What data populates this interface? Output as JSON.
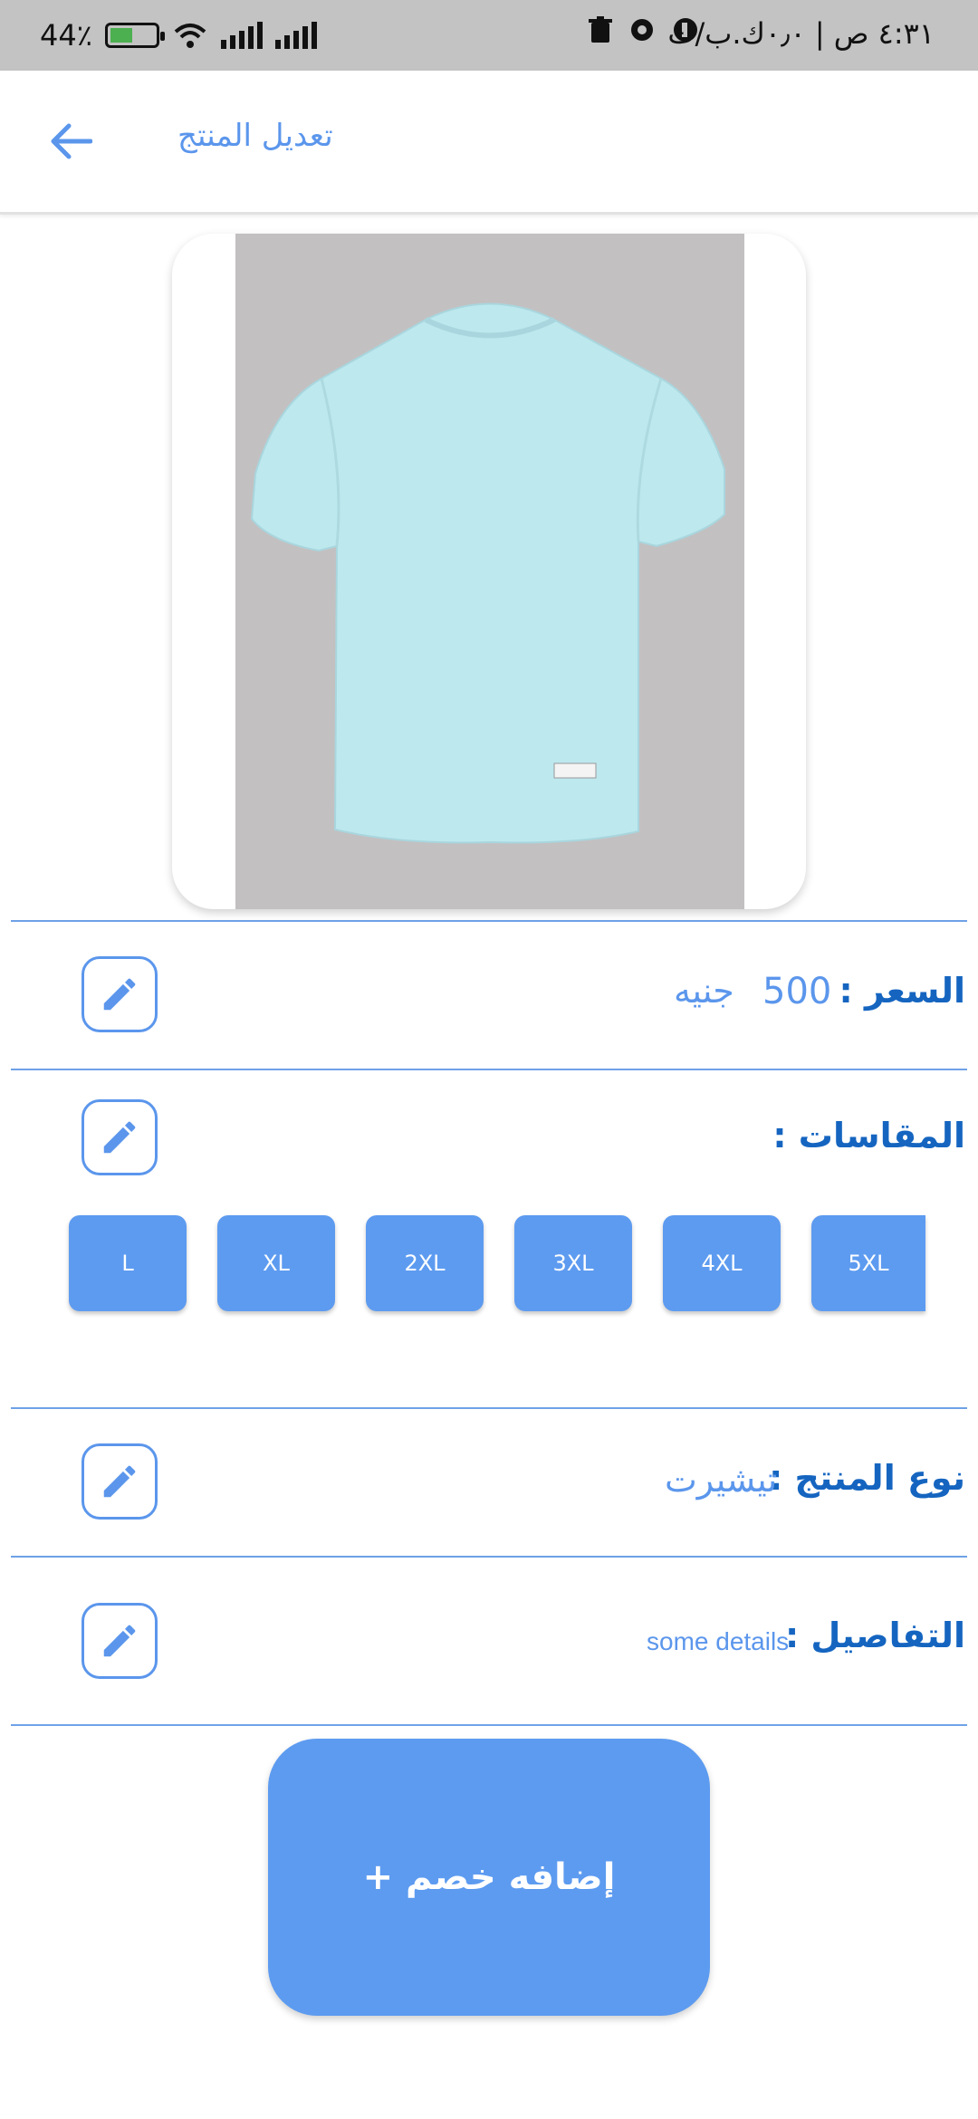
{
  "status_bar": {
    "time": "٤:٣١ ص | ٠٫٠ك.ب/ث",
    "battery": "44٪"
  },
  "header": {
    "title": "تعديل المنتج",
    "back_icon": "arrow-left-icon"
  },
  "product_image": {
    "icon": "tshirt-image",
    "shirt_color": "#bde8ee",
    "background_color": "#c3c0c1"
  },
  "price": {
    "label": "السعر :",
    "value": "500",
    "currency": "جنيه",
    "edit_icon": "pencil-icon"
  },
  "sizes": {
    "label": "المقاسات :",
    "edit_icon": "pencil-icon",
    "items": [
      "L",
      "XL",
      "2XL",
      "3XL",
      "4XL",
      "5XL"
    ]
  },
  "product_type": {
    "label": "نوع المنتج :",
    "value": "تيشيرت",
    "edit_icon": "pencil-icon"
  },
  "details": {
    "label": "التفاصيل :",
    "value": "some details",
    "edit_icon": "pencil-icon"
  },
  "discount_button": {
    "label": "إضافه خصم +"
  },
  "colors": {
    "accent": "#5d9bf0",
    "label_blue": "#1565c0",
    "value_blue": "#5b96ec"
  }
}
